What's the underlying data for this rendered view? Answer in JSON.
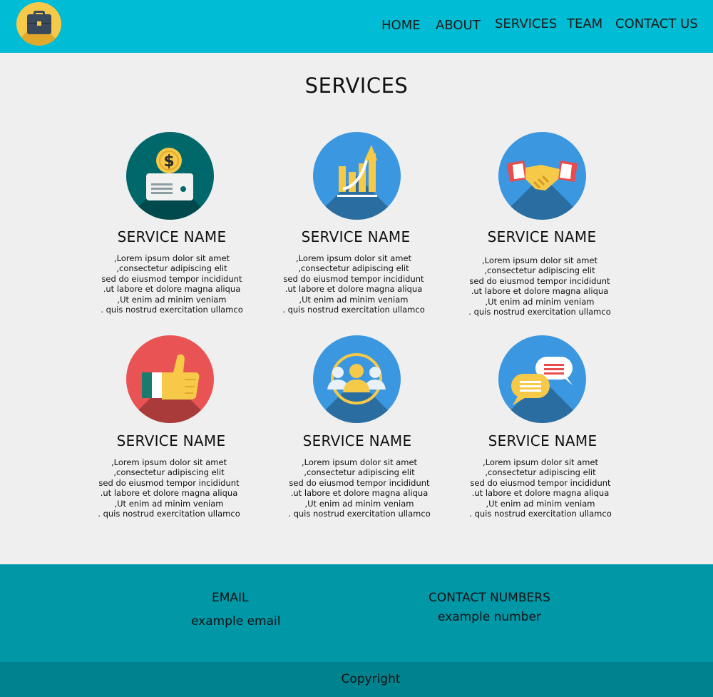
{
  "header": {
    "logo_icon": "briefcase-icon",
    "nav": [
      "HOME",
      "ABOUT",
      "SERVICES",
      "TEAM",
      "CONTACT US"
    ]
  },
  "main": {
    "title": "SERVICES",
    "services": [
      {
        "icon": "dollar-card-icon",
        "color": "#00676b",
        "name": "SERVICE NAME",
        "description": ",Lorem ipsum dolor sit amet\n,consectetur adipiscing elit\nsed do eiusmod tempor incididunt\n.ut labore et dolore magna aliqua\n,Ut enim ad minim veniam\n. quis nostrud exercitation ullamco"
      },
      {
        "icon": "growth-chart-icon",
        "color": "#3b97df",
        "name": "SERVICE NAME",
        "description": ",Lorem ipsum dolor sit amet\n,consectetur adipiscing elit\nsed do eiusmod tempor incididunt\n.ut labore et dolore magna aliqua\n,Ut enim ad minim veniam\n. quis nostrud exercitation ullamco"
      },
      {
        "icon": "handshake-icon",
        "color": "#3b97df",
        "name": "SERVICE NAME",
        "description": ",Lorem ipsum dolor sit amet\n,consectetur adipiscing elit\nsed do eiusmod tempor incididunt\n.ut labore et dolore magna aliqua\n,Ut enim ad minim veniam\n. quis nostrud exercitation ullamco"
      },
      {
        "icon": "thumbs-up-icon",
        "color": "#ea5353",
        "name": "SERVICE NAME",
        "description": ",Lorem ipsum dolor sit amet\n,consectetur adipiscing elit\nsed do eiusmod tempor incididunt\n.ut labore et dolore magna aliqua\n,Ut enim ad minim veniam\n. quis nostrud exercitation ullamco"
      },
      {
        "icon": "team-people-icon",
        "color": "#3b97df",
        "name": "SERVICE NAME",
        "description": ",Lorem ipsum dolor sit amet\n,consectetur adipiscing elit\nsed do eiusmod tempor incididunt\n.ut labore et dolore magna aliqua\n,Ut enim ad minim veniam\n. quis nostrud exercitation ullamco"
      },
      {
        "icon": "chat-bubbles-icon",
        "color": "#3b97df",
        "name": "SERVICE NAME",
        "description": ",Lorem ipsum dolor sit amet\n,consectetur adipiscing elit\nsed do eiusmod tempor incididunt\n.ut labore et dolore magna aliqua\n,Ut enim ad minim veniam\n. quis nostrud exercitation ullamco"
      }
    ]
  },
  "footer": {
    "email_label": "EMAIL",
    "email_value": "example email",
    "phone_label": "CONTACT NUMBERS",
    "phone_value": "example number",
    "copyright": "Copyright"
  },
  "colors": {
    "header_bg": "#00bcd4",
    "page_bg": "#efefef",
    "footer_bg": "#0097a7",
    "copyright_bg": "#00838f",
    "logo_bg": "#f7c948"
  }
}
